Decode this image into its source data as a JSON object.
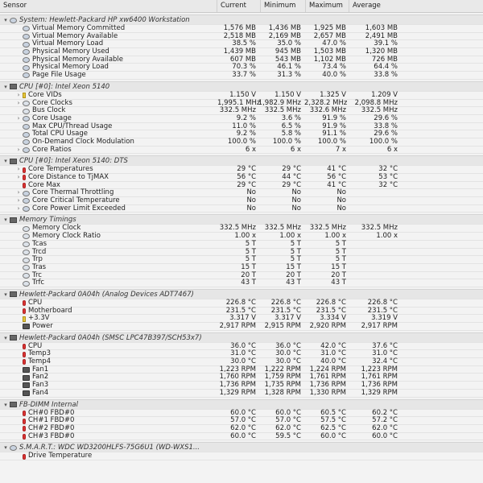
{
  "header": [
    "Sensor",
    "Current",
    "Minimum",
    "Maximum",
    "Average"
  ],
  "rows": [
    {
      "t": "sec",
      "label": "System: Hewlett-Packard HP xw6400 Workstation",
      "icon": "sensor"
    },
    {
      "t": "r",
      "label": "Virtual Memory Committed",
      "icon": "sensor",
      "v": [
        "1,576 MB",
        "1,436 MB",
        "1,925 MB",
        "1,603 MB"
      ]
    },
    {
      "t": "r",
      "label": "Virtual Memory Available",
      "icon": "sensor",
      "v": [
        "2,518 MB",
        "2,169 MB",
        "2,657 MB",
        "2,491 MB"
      ]
    },
    {
      "t": "r",
      "label": "Virtual Memory Load",
      "icon": "sensor",
      "v": [
        "38.5 %",
        "35.0 %",
        "47.0 %",
        "39.1 %"
      ]
    },
    {
      "t": "r",
      "label": "Physical Memory Used",
      "icon": "sensor",
      "v": [
        "1,439 MB",
        "945 MB",
        "1,503 MB",
        "1,320 MB"
      ]
    },
    {
      "t": "r",
      "label": "Physical Memory Available",
      "icon": "sensor",
      "v": [
        "607 MB",
        "543 MB",
        "1,102 MB",
        "726 MB"
      ]
    },
    {
      "t": "r",
      "label": "Physical Memory Load",
      "icon": "sensor",
      "v": [
        "70.3 %",
        "46.1 %",
        "73.4 %",
        "64.4 %"
      ]
    },
    {
      "t": "r",
      "label": "Page File Usage",
      "icon": "sensor",
      "v": [
        "33.7 %",
        "31.3 %",
        "40.0 %",
        "33.8 %"
      ]
    },
    {
      "t": "sec",
      "label": "CPU [#0]: Intel Xeon 5140",
      "icon": "chip"
    },
    {
      "t": "r",
      "label": "Core VIDs",
      "icon": "volt",
      "caret": true,
      "v": [
        "1.150 V",
        "1.150 V",
        "1.325 V",
        "1.209 V"
      ]
    },
    {
      "t": "r",
      "label": "Core Clocks",
      "icon": "clock",
      "caret": true,
      "v": [
        "1,995.1 MHz",
        "1,982.9 MHz",
        "2,328.2 MHz",
        "2,098.8 MHz"
      ]
    },
    {
      "t": "r",
      "label": "Bus Clock",
      "icon": "clock",
      "v": [
        "332.5 MHz",
        "332.5 MHz",
        "332.6 MHz",
        "332.5 MHz"
      ]
    },
    {
      "t": "r",
      "label": "Core Usage",
      "icon": "sensor",
      "caret": true,
      "v": [
        "9.2 %",
        "3.6 %",
        "91.9 %",
        "29.6 %"
      ]
    },
    {
      "t": "r",
      "label": "Max CPU/Thread Usage",
      "icon": "sensor",
      "v": [
        "11.0 %",
        "6.5 %",
        "91.9 %",
        "33.8 %"
      ]
    },
    {
      "t": "r",
      "label": "Total CPU Usage",
      "icon": "sensor",
      "v": [
        "9.2 %",
        "5.8 %",
        "91.1 %",
        "29.6 %"
      ]
    },
    {
      "t": "r",
      "label": "On-Demand Clock Modulation",
      "icon": "sensor",
      "v": [
        "100.0 %",
        "100.0 %",
        "100.0 %",
        "100.0 %"
      ]
    },
    {
      "t": "r",
      "label": "Core Ratios",
      "icon": "sensor",
      "caret": true,
      "v": [
        "6 x",
        "6 x",
        "7 x",
        "6 x"
      ]
    },
    {
      "t": "sec",
      "label": "CPU [#0]: Intel Xeon 5140: DTS",
      "icon": "chip"
    },
    {
      "t": "r",
      "label": "Core Temperatures",
      "icon": "temp",
      "caret": true,
      "v": [
        "29 °C",
        "29 °C",
        "41 °C",
        "32 °C"
      ]
    },
    {
      "t": "r",
      "label": "Core Distance to TjMAX",
      "icon": "temp",
      "caret": true,
      "v": [
        "56 °C",
        "44 °C",
        "56 °C",
        "53 °C"
      ]
    },
    {
      "t": "r",
      "label": "Core Max",
      "icon": "temp",
      "v": [
        "29 °C",
        "29 °C",
        "41 °C",
        "32 °C"
      ]
    },
    {
      "t": "r",
      "label": "Core Thermal Throttling",
      "icon": "sensor",
      "caret": true,
      "v": [
        "No",
        "No",
        "No",
        ""
      ]
    },
    {
      "t": "r",
      "label": "Core Critical Temperature",
      "icon": "sensor",
      "caret": true,
      "v": [
        "No",
        "No",
        "No",
        ""
      ]
    },
    {
      "t": "r",
      "label": "Core Power Limit Exceeded",
      "icon": "sensor",
      "caret": true,
      "v": [
        "No",
        "No",
        "No",
        ""
      ]
    },
    {
      "t": "sec",
      "label": "Memory Timings",
      "icon": "chip"
    },
    {
      "t": "r",
      "label": "Memory Clock",
      "icon": "clock",
      "v": [
        "332.5 MHz",
        "332.5 MHz",
        "332.5 MHz",
        "332.5 MHz"
      ]
    },
    {
      "t": "r",
      "label": "Memory Clock Ratio",
      "icon": "clock",
      "v": [
        "1.00 x",
        "1.00 x",
        "1.00 x",
        "1.00 x"
      ]
    },
    {
      "t": "r",
      "label": "Tcas",
      "icon": "clock",
      "v": [
        "5 T",
        "5 T",
        "5 T",
        ""
      ]
    },
    {
      "t": "r",
      "label": "Trcd",
      "icon": "clock",
      "v": [
        "5 T",
        "5 T",
        "5 T",
        ""
      ]
    },
    {
      "t": "r",
      "label": "Trp",
      "icon": "clock",
      "v": [
        "5 T",
        "5 T",
        "5 T",
        ""
      ]
    },
    {
      "t": "r",
      "label": "Tras",
      "icon": "clock",
      "v": [
        "15 T",
        "15 T",
        "15 T",
        ""
      ]
    },
    {
      "t": "r",
      "label": "Trc",
      "icon": "clock",
      "v": [
        "20 T",
        "20 T",
        "20 T",
        ""
      ]
    },
    {
      "t": "r",
      "label": "Trfc",
      "icon": "clock",
      "v": [
        "43 T",
        "43 T",
        "43 T",
        ""
      ]
    },
    {
      "t": "sec",
      "label": "Hewlett-Packard 0A04h (Analog Devices ADT7467)",
      "icon": "chip"
    },
    {
      "t": "r",
      "label": "CPU",
      "icon": "temp",
      "v": [
        "226.8 °C",
        "226.8 °C",
        "226.8 °C",
        "226.8 °C"
      ]
    },
    {
      "t": "r",
      "label": "Motherboard",
      "icon": "temp",
      "v": [
        "231.5 °C",
        "231.5 °C",
        "231.5 °C",
        "231.5 °C"
      ]
    },
    {
      "t": "r",
      "label": "+3.3V",
      "icon": "volt",
      "v": [
        "3.317 V",
        "3.317 V",
        "3.334 V",
        "3.319 V"
      ]
    },
    {
      "t": "r",
      "label": "Power",
      "icon": "fan",
      "v": [
        "2,917 RPM",
        "2,915 RPM",
        "2,920 RPM",
        "2,917 RPM"
      ]
    },
    {
      "t": "sec",
      "label": "Hewlett-Packard 0A04h (SMSC LPC47B397/SCH53x7)",
      "icon": "chip"
    },
    {
      "t": "r",
      "label": "CPU",
      "icon": "temp",
      "v": [
        "36.0 °C",
        "36.0 °C",
        "42.0 °C",
        "37.6 °C"
      ]
    },
    {
      "t": "r",
      "label": "Temp3",
      "icon": "temp",
      "v": [
        "31.0 °C",
        "30.0 °C",
        "31.0 °C",
        "31.0 °C"
      ]
    },
    {
      "t": "r",
      "label": "Temp4",
      "icon": "temp",
      "v": [
        "30.0 °C",
        "30.0 °C",
        "40.0 °C",
        "32.4 °C"
      ]
    },
    {
      "t": "r",
      "label": "Fan1",
      "icon": "fan",
      "v": [
        "1,223 RPM",
        "1,222 RPM",
        "1,224 RPM",
        "1,223 RPM"
      ]
    },
    {
      "t": "r",
      "label": "Fan2",
      "icon": "fan",
      "v": [
        "1,760 RPM",
        "1,759 RPM",
        "1,761 RPM",
        "1,761 RPM"
      ]
    },
    {
      "t": "r",
      "label": "Fan3",
      "icon": "fan",
      "v": [
        "1,736 RPM",
        "1,735 RPM",
        "1,736 RPM",
        "1,736 RPM"
      ]
    },
    {
      "t": "r",
      "label": "Fan4",
      "icon": "fan",
      "v": [
        "1,329 RPM",
        "1,328 RPM",
        "1,330 RPM",
        "1,329 RPM"
      ]
    },
    {
      "t": "sec",
      "label": "FB-DIMM Internal",
      "icon": "chip"
    },
    {
      "t": "r",
      "label": "CH#0 FBD#0",
      "icon": "temp",
      "v": [
        "60.0 °C",
        "60.0 °C",
        "60.5 °C",
        "60.2 °C"
      ]
    },
    {
      "t": "r",
      "label": "CH#1 FBD#0",
      "icon": "temp",
      "v": [
        "57.0 °C",
        "57.0 °C",
        "57.5 °C",
        "57.2 °C"
      ]
    },
    {
      "t": "r",
      "label": "CH#2 FBD#0",
      "icon": "temp",
      "v": [
        "62.0 °C",
        "62.0 °C",
        "62.5 °C",
        "62.0 °C"
      ]
    },
    {
      "t": "r",
      "label": "CH#3 FBD#0",
      "icon": "temp",
      "v": [
        "60.0 °C",
        "59.5 °C",
        "60.0 °C",
        "60.0 °C"
      ]
    },
    {
      "t": "sec",
      "label": "S.M.A.R.T.: WDC WD3200HLFS-75G6U1 (WD-WXS1...",
      "icon": "sensor"
    },
    {
      "t": "r",
      "label": "Drive Temperature",
      "icon": "temp",
      "v": [
        "",
        "",
        "",
        ""
      ]
    }
  ]
}
